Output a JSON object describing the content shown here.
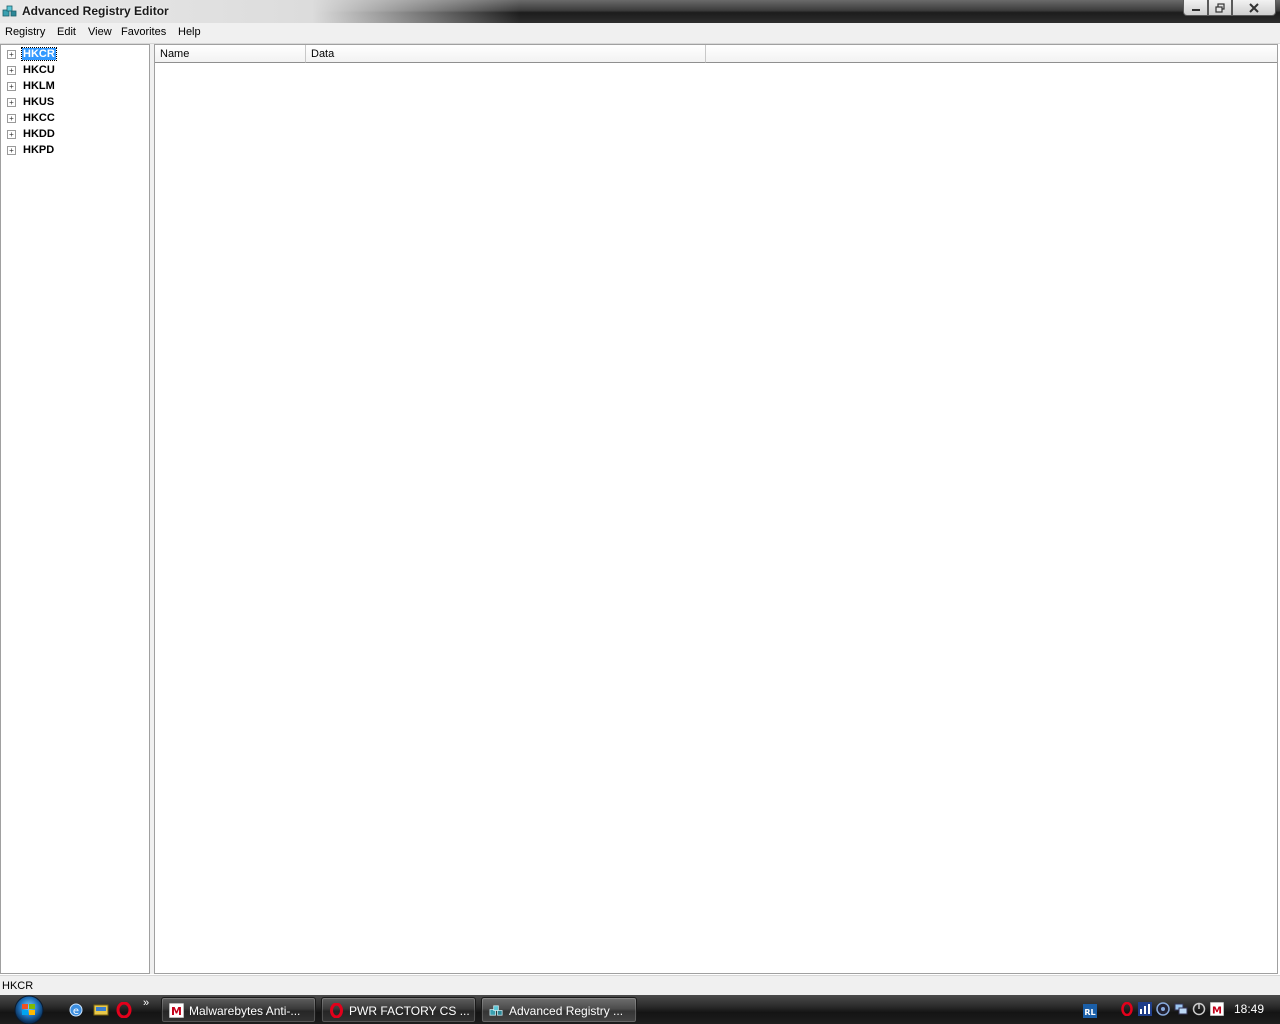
{
  "window": {
    "title": "Advanced Registry Editor"
  },
  "menu": {
    "items": [
      "Registry",
      "Edit",
      "View",
      "Favorites",
      "Help"
    ]
  },
  "tree": {
    "items": [
      {
        "label": "HKCR",
        "selected": true
      },
      {
        "label": "HKCU",
        "selected": false
      },
      {
        "label": "HKLM",
        "selected": false
      },
      {
        "label": "HKUS",
        "selected": false
      },
      {
        "label": "HKCC",
        "selected": false
      },
      {
        "label": "HKDD",
        "selected": false
      },
      {
        "label": "HKPD",
        "selected": false
      }
    ],
    "expander_glyph": "+"
  },
  "list": {
    "columns": [
      "Name",
      "Data"
    ]
  },
  "status": {
    "text": "HKCR"
  },
  "taskbar": {
    "quicklaunch_more": "»",
    "buttons": [
      {
        "label": "Malwarebytes Anti-...",
        "icon": "malwarebytes-icon",
        "active": false
      },
      {
        "label": "PWR FACTORY CS ...",
        "icon": "opera-icon",
        "active": false
      },
      {
        "label": "Advanced Registry ...",
        "icon": "registry-editor-icon",
        "active": true
      }
    ],
    "tray_icons": [
      "rl-icon",
      "opera-tray-icon",
      "network-meter-icon",
      "audio-icon",
      "network-icon",
      "power-icon",
      "malwarebytes-tray-icon"
    ],
    "clock": "18:49"
  },
  "colors": {
    "selection": "#3399ff",
    "taskbar": "#1d1d1d",
    "menubar": "#f0f0f0"
  }
}
